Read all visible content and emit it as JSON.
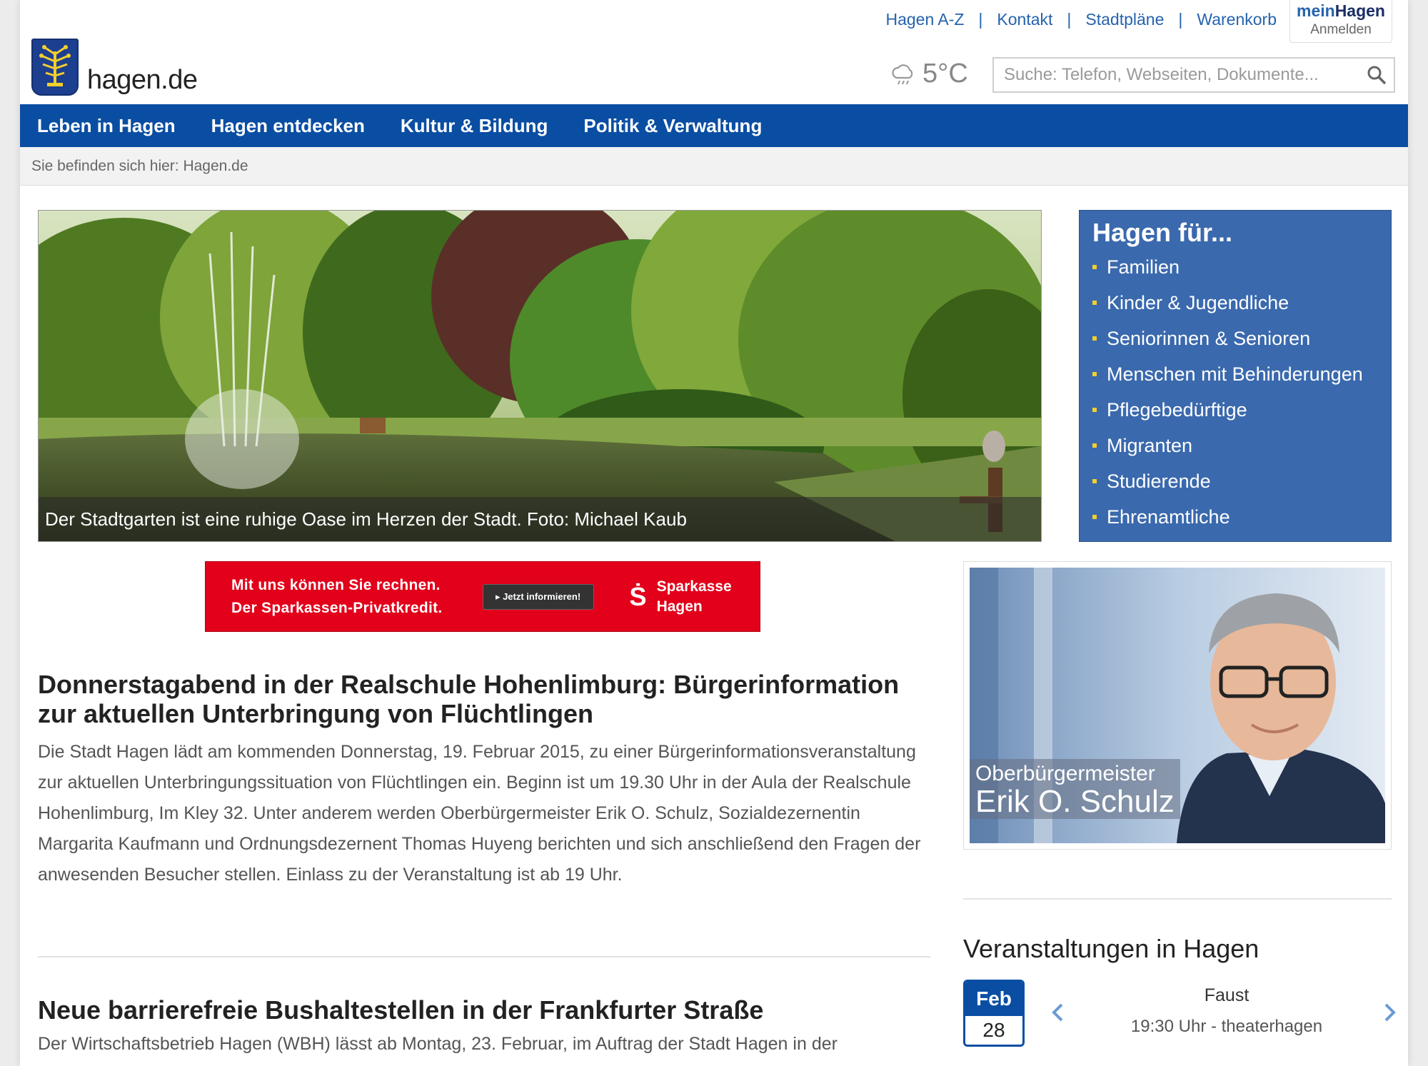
{
  "site": {
    "logo_text": "hagen.de"
  },
  "toplinks": [
    "Hagen A-Z",
    "Kontakt",
    "Stadtpläne",
    "Warenkorb"
  ],
  "mein": {
    "brand_light": "mein",
    "brand_bold": "Hagen",
    "login": "Anmelden"
  },
  "weather": {
    "temp": "5°C",
    "icon": "cloud-rain-icon"
  },
  "search": {
    "placeholder": "Suche: Telefon, Webseiten, Dokumente..."
  },
  "nav": [
    "Leben in Hagen",
    "Hagen entdecken",
    "Kultur & Bildung",
    "Politik & Verwaltung"
  ],
  "breadcrumb": "Sie befinden sich hier: Hagen.de",
  "hero": {
    "caption": "Der Stadtgarten ist eine ruhige Oase im Herzen der Stadt. Foto: Michael Kaub"
  },
  "hagen_fuer": {
    "title": "Hagen für...",
    "items": [
      "Familien",
      "Kinder & Jugendliche",
      "Seniorinnen & Senioren",
      "Menschen mit Behinderungen",
      "Pflegebedürftige",
      "Migranten",
      "Studierende",
      "Ehrenamtliche"
    ]
  },
  "ad": {
    "line1": "Mit uns können Sie rechnen.",
    "line2": "Der Sparkassen-Privatkredit.",
    "button": "▸ Jetzt informieren!",
    "brand_symbol": "Ṡ",
    "brand_line1": "Sparkasse",
    "brand_line2": "Hagen"
  },
  "mayor": {
    "role": "Oberbürgermeister",
    "name": "Erik O. Schulz"
  },
  "articles": [
    {
      "title": "Donnerstagabend in der Realschule Hohenlimburg: Bürgerinformation zur aktuellen Unterbringung von Flüchtlingen",
      "body": "Die Stadt Hagen lädt am kommenden Donnerstag, 19. Februar 2015, zu einer Bürgerinformationsveranstaltung zur aktuellen Unterbringungssituation von Flüchtlingen ein. Beginn ist um 19.30 Uhr in der Aula der Realschule Hohenlimburg, Im Kley 32. Unter anderem werden Oberbürgermeister Erik O. Schulz, Sozialdezernentin Margarita Kaufmann und Ordnungsdezernent Thomas Huyeng berichten und sich anschließend den Fragen der anwesenden Besucher stellen. Einlass zu der Veranstaltung ist ab 19 Uhr."
    },
    {
      "title": "Neue barrierefreie Bushaltestellen in der Frankfurter Straße",
      "body": "Der Wirtschaftsbetrieb Hagen (WBH) lässt ab Montag, 23. Februar, im Auftrag der Stadt Hagen in der"
    }
  ],
  "events": {
    "title": "Veranstaltungen in Hagen",
    "month": "Feb",
    "day": "28",
    "name": "Faust",
    "detail": "19:30 Uhr - theaterhagen"
  },
  "colors": {
    "nav_blue": "#0a4ea3",
    "box_blue": "#3a69ad",
    "link_blue": "#2563ad",
    "ad_red": "#e2001a",
    "bullet_yellow": "#f3cf2e"
  }
}
